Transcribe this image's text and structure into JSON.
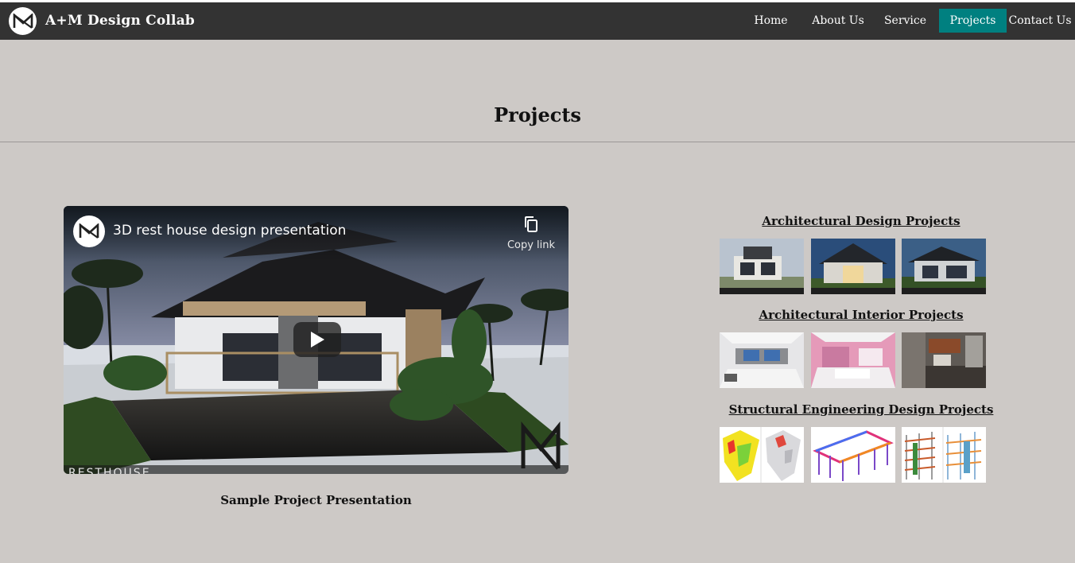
{
  "brand": {
    "name": "A+M Design Collab",
    "logo_icon": "am-logo-icon"
  },
  "nav": {
    "items": [
      {
        "label": "Home"
      },
      {
        "label": "About Us"
      },
      {
        "label": "Service"
      },
      {
        "label": "Projects",
        "active": true
      },
      {
        "label": "Contact Us"
      }
    ],
    "active_color": "#008080"
  },
  "page": {
    "title": "Projects"
  },
  "video": {
    "title": "3D rest house design presentation",
    "copy_link_label": "Copy link",
    "watermark": "RESTHOUSE",
    "caption": "Sample Project Presentation"
  },
  "categories": [
    {
      "heading": "Architectural Design Projects",
      "thumbs": [
        "house-exterior-1",
        "house-exterior-2",
        "house-exterior-3"
      ]
    },
    {
      "heading": "Architectural Interior Projects",
      "thumbs": [
        "bedroom-blue",
        "bedroom-pink",
        "kitchen"
      ]
    },
    {
      "heading": "Structural Engineering Design Projects",
      "thumbs": [
        "structural-model-1",
        "structural-frame-2",
        "structural-frame-3"
      ]
    }
  ],
  "colors": {
    "navbar": "#333333",
    "background": "#cdc9c6",
    "accent": "#008080"
  }
}
